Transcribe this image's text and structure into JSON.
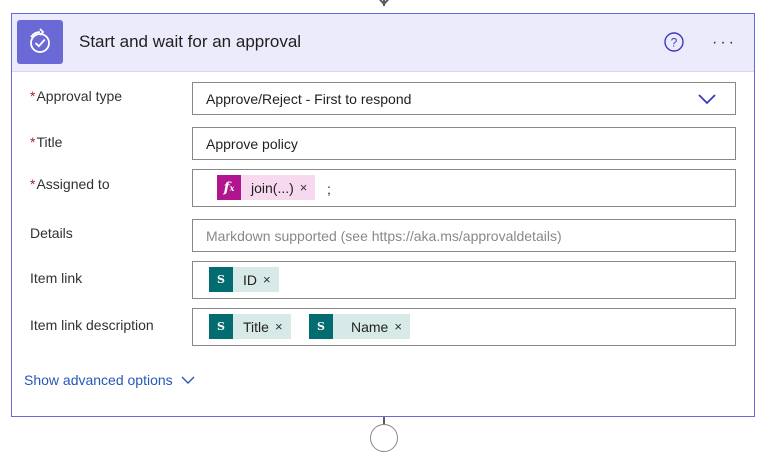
{
  "card": {
    "title": "Start and wait for an approval",
    "icon": "approval-icon",
    "help_icon": "help-circle-icon",
    "more_label": "···"
  },
  "fields": {
    "approval_type": {
      "label": "Approval type",
      "required": true,
      "value": "Approve/Reject - First to respond"
    },
    "title": {
      "label": "Title",
      "required": true,
      "value": "Approve policy"
    },
    "assigned_to": {
      "label": "Assigned to",
      "required": true,
      "tokens": [
        {
          "type": "expression",
          "label": "join(...)",
          "icon": "fx-icon"
        }
      ],
      "suffix": ";"
    },
    "details": {
      "label": "Details",
      "required": false,
      "placeholder": "Markdown supported (see https://aka.ms/approvaldetails)"
    },
    "item_link": {
      "label": "Item link",
      "required": false,
      "tokens": [
        {
          "type": "sharepoint",
          "label": "ID",
          "icon": "sharepoint-icon"
        }
      ]
    },
    "item_link_description": {
      "label": "Item link description",
      "required": false,
      "tokens": [
        {
          "type": "sharepoint",
          "label": "Title",
          "icon": "sharepoint-icon"
        },
        {
          "type": "sharepoint",
          "label": "Name",
          "icon": "sharepoint-icon"
        }
      ]
    }
  },
  "required_marker": "*",
  "token_remove": "×",
  "advanced_options": "Show advanced options",
  "colors": {
    "accent": "#6b69d6",
    "header_bg": "#ecebfb",
    "expression_token": "#f6d9ee",
    "expression_icon": "#b1148f",
    "sharepoint_token": "#d7eae8",
    "sharepoint_icon": "#036c70",
    "link": "#2558b8",
    "required": "#a4262c"
  }
}
